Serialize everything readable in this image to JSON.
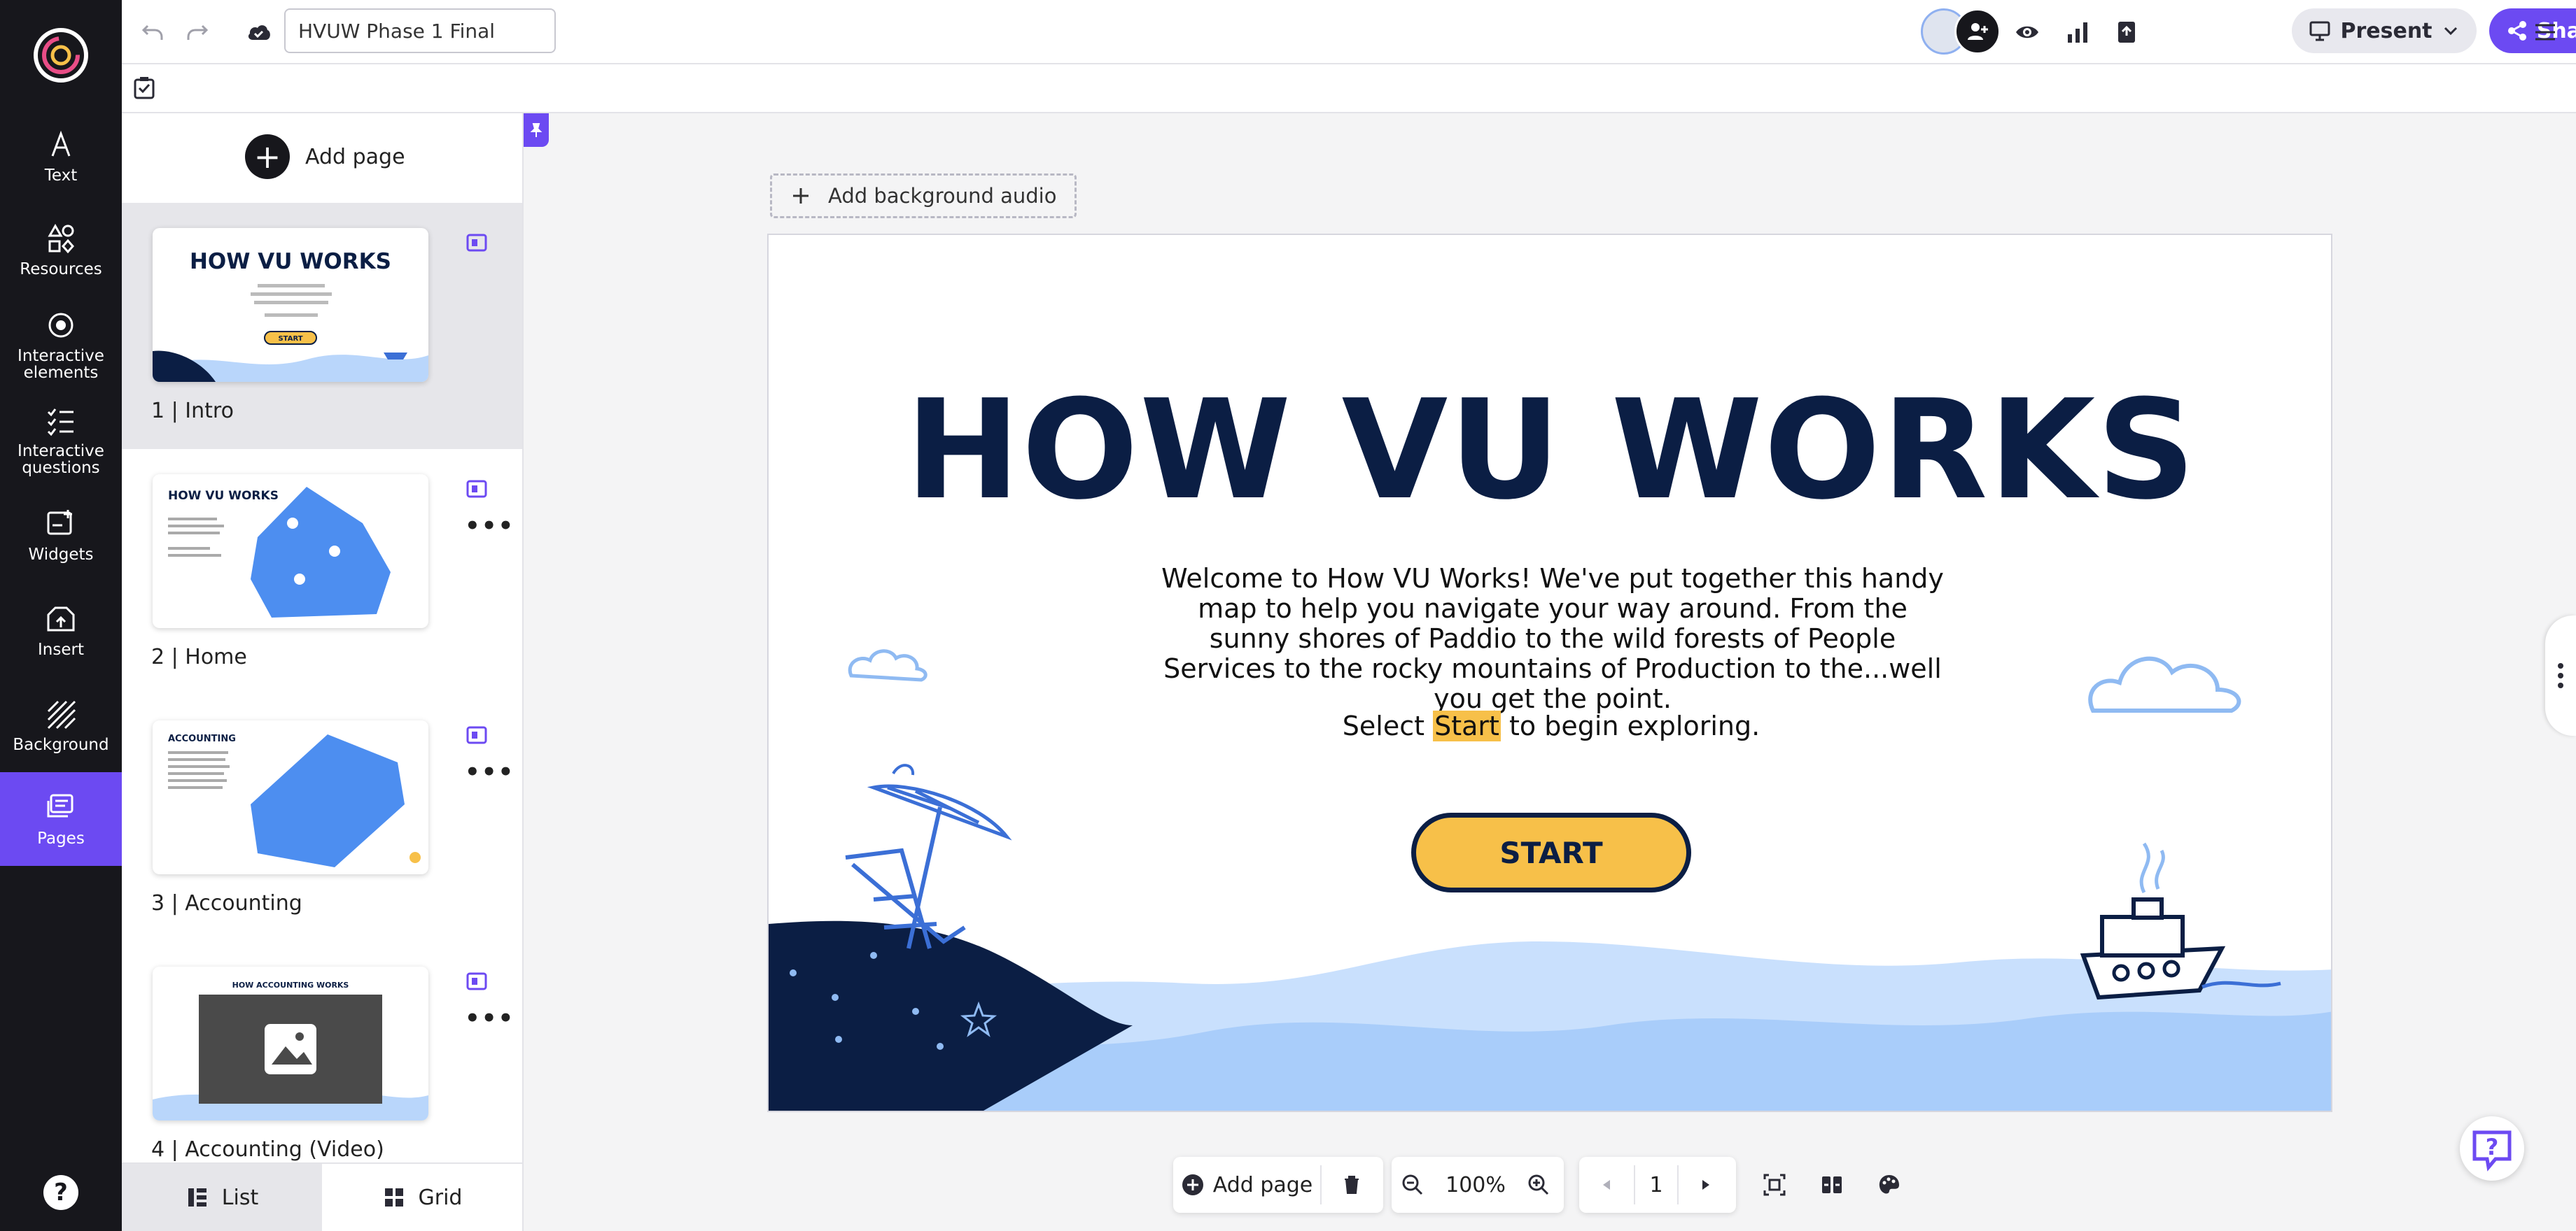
{
  "rail": {
    "items": [
      {
        "label": "Text",
        "icon": "text-icon"
      },
      {
        "label": "Resources",
        "icon": "resources-icon"
      },
      {
        "label": "Interactive elements",
        "icon": "interactive-elements-icon"
      },
      {
        "label": "Interactive questions",
        "icon": "interactive-questions-icon"
      },
      {
        "label": "Widgets",
        "icon": "widgets-icon"
      },
      {
        "label": "Insert",
        "icon": "insert-icon"
      },
      {
        "label": "Background",
        "icon": "background-icon"
      },
      {
        "label": "Pages",
        "icon": "pages-icon"
      }
    ],
    "active": "Pages",
    "help_glyph": "?"
  },
  "topbar": {
    "project_title": "HVUW Phase 1 Final",
    "present_label": "Present",
    "share_label": "Share"
  },
  "panel": {
    "add_page_label": "Add page",
    "pages": [
      {
        "number": "1",
        "label": "1 |  Intro"
      },
      {
        "number": "2",
        "label": "2 |  Home"
      },
      {
        "number": "3",
        "label": "3 |  Accounting"
      },
      {
        "number": "4",
        "label": "4 |  Accounting (Video)"
      }
    ],
    "view_list_label": "List",
    "view_grid_label": "Grid"
  },
  "canvas": {
    "audio_label": "Add background audio",
    "slide": {
      "title": "HOW VU WORKS",
      "body": "Welcome to How VU Works! We've put together this handy map to help you navigate your way around. From the sunny shores of Paddio to the wild forests of People Services to the rocky mountains of Production to the...well you get the point.",
      "cta_before": "Select ",
      "cta_highlight": "Start",
      "cta_after": " to begin exploring.",
      "start_label": "START"
    }
  },
  "thumbs": {
    "t1_title": "HOW VU WORKS",
    "t1_start": "START",
    "t2_title": "HOW VU WORKS",
    "t3_title": "ACCOUNTING",
    "t4_title": "HOW ACCOUNTING WORKS"
  },
  "bottombar": {
    "add_page_label": "Add page",
    "zoom": "100%",
    "page_number": "1"
  },
  "colors": {
    "accent": "#6c4af2",
    "navy": "#0b1e44",
    "yellow": "#f7c049",
    "wave_light": "#b9d6fb",
    "wave_mid": "#9ec4f7"
  }
}
